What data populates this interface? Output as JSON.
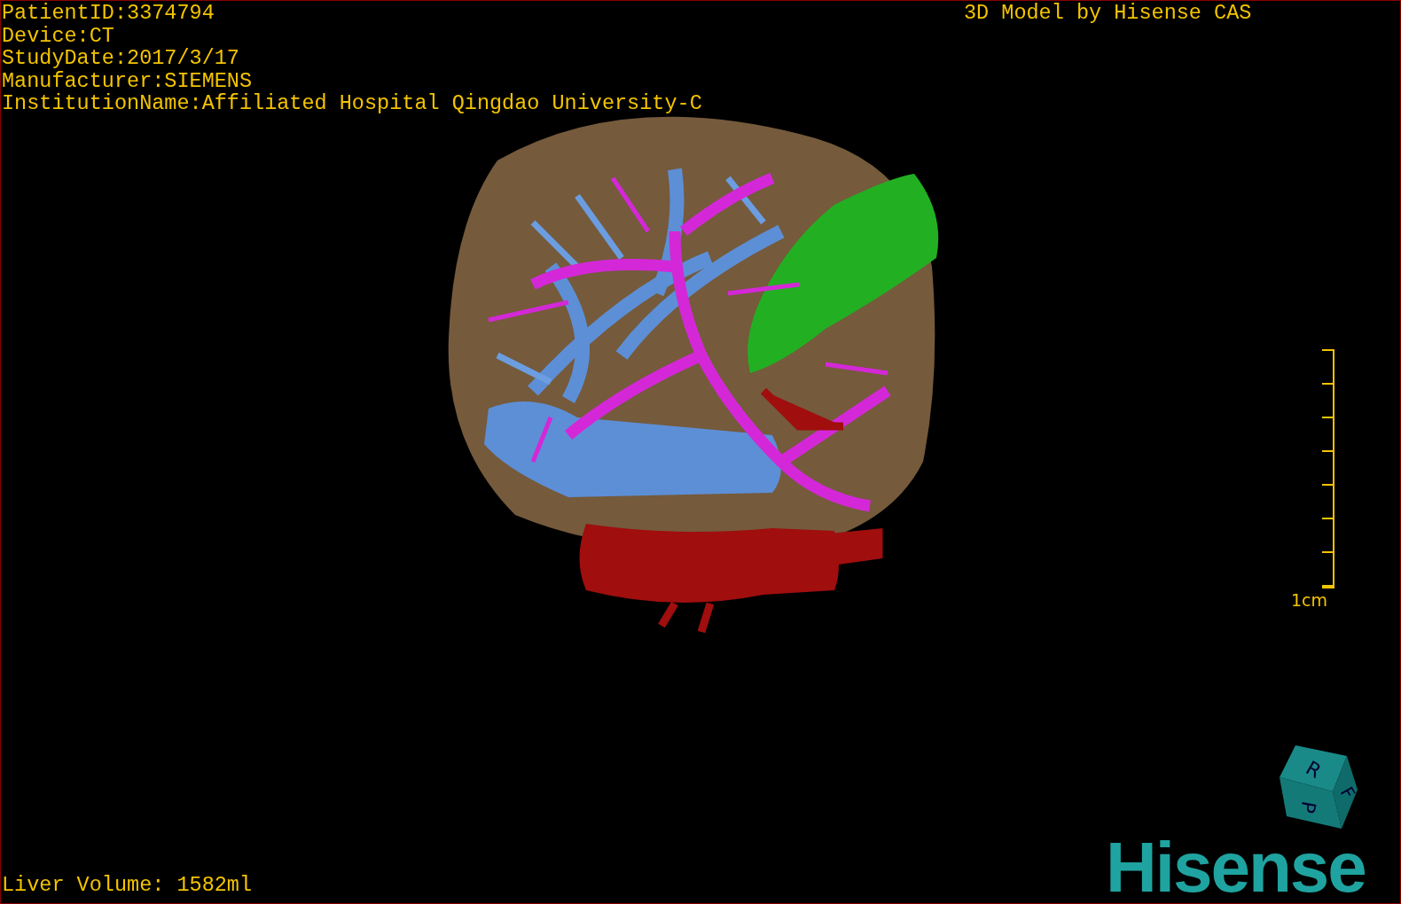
{
  "info_lines": [
    "PatientID:3374794",
    "Device:CT",
    "StudyDate:2017/3/17",
    "Manufacturer:SIEMENS",
    "InstitutionName:Affiliated Hospital Qingdao University-C"
  ],
  "credit": "3D Model by Hisense CAS",
  "scale_bar": {
    "label": "1cm"
  },
  "orientation_cube": {
    "labels": [
      "R",
      "F",
      "P"
    ]
  },
  "footer": "Liver Volume: 1582ml",
  "logo": "Hisense"
}
